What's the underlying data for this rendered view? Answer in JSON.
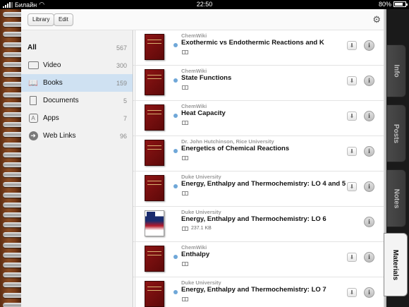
{
  "status": {
    "carrier": "Билайн",
    "time": "22:50",
    "battery": "80%"
  },
  "toolbar": {
    "library_label": "Library",
    "edit_label": "Edit",
    "gear_icon": "gear-icon"
  },
  "sidebar": {
    "items": [
      {
        "label": "All",
        "count": "567",
        "icon": "none",
        "selected": false
      },
      {
        "label": "Video",
        "count": "300",
        "icon": "monitor-icon",
        "selected": false
      },
      {
        "label": "Books",
        "count": "159",
        "icon": "open-book-icon",
        "selected": true
      },
      {
        "label": "Documents",
        "count": "5",
        "icon": "document-icon",
        "selected": false
      },
      {
        "label": "Apps",
        "count": "7",
        "icon": "app-store-icon",
        "selected": false
      },
      {
        "label": "Web Links",
        "count": "96",
        "icon": "link-arrow-icon",
        "selected": false
      }
    ]
  },
  "list": {
    "rows": [
      {
        "author": "ChemWiki",
        "title": "Exothermic vs Endothermic Reactions and K",
        "size": "",
        "thumb": "red-book",
        "download": true
      },
      {
        "author": "ChemWiki",
        "title": "State Functions",
        "size": "",
        "thumb": "red-book",
        "download": true
      },
      {
        "author": "ChemWiki",
        "title": "Heat Capacity",
        "size": "",
        "thumb": "red-book",
        "download": true
      },
      {
        "author": "Dr. John Hutchinson, Rice University",
        "title": "Energetics of Chemical Reactions",
        "size": "",
        "thumb": "red-book",
        "download": true
      },
      {
        "author": "Duke University",
        "title": "Energy, Enthalpy and Thermochemistry: LO 4 and 5",
        "size": "",
        "thumb": "red-book",
        "download": true
      },
      {
        "author": "Duke University",
        "title": "Energy, Enthalpy and Thermochemistry: LO 6",
        "size": "237.1 KB",
        "thumb": "duke-cover",
        "download": false
      },
      {
        "author": "ChemWiki",
        "title": "Enthalpy",
        "size": "",
        "thumb": "red-book",
        "download": true
      },
      {
        "author": "Duke University",
        "title": "Energy, Enthalpy and Thermochemistry: LO 7",
        "size": "",
        "thumb": "red-book",
        "download": true
      }
    ]
  },
  "tabs": [
    {
      "label": "Info",
      "active": false
    },
    {
      "label": "Posts",
      "active": false
    },
    {
      "label": "Notes",
      "active": false
    },
    {
      "label": "Materials",
      "active": true
    }
  ],
  "colors": {
    "selected": "#cfe1f2",
    "dot": "#6fa7d8",
    "leather": "#8a4a22"
  }
}
